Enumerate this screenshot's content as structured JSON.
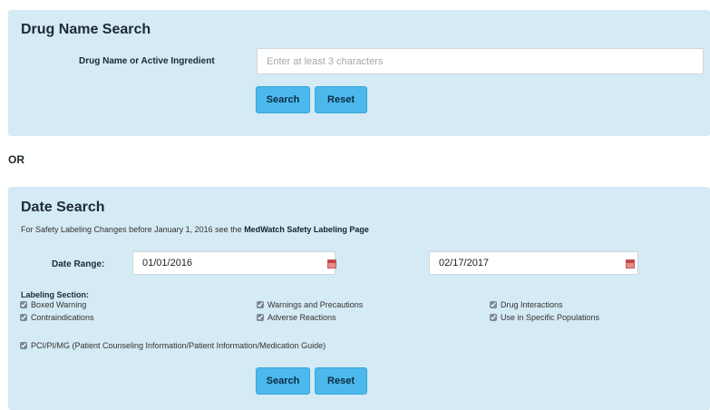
{
  "drug_search": {
    "title": "Drug Name Search",
    "field_label": "Drug Name or Active Ingredient",
    "placeholder": "Enter at least 3 characters",
    "value": "",
    "search_label": "Search",
    "reset_label": "Reset"
  },
  "or_label": "OR",
  "date_search": {
    "title": "Date Search",
    "note_prefix": "For Safety Labeling Changes before January 1, 2016 see the",
    "note_link": "MedWatch Safety Labeling Page",
    "date_range_label": "Date Range:",
    "start_date": "01/01/2016",
    "end_date": "02/17/2017",
    "calendar_icon": "calendar-icon",
    "labeling_section_label": "Labeling Section:",
    "checkboxes": [
      {
        "label": "Boxed Warning",
        "checked": true
      },
      {
        "label": "Warnings and Precautions",
        "checked": true
      },
      {
        "label": "Drug Interactions",
        "checked": true
      },
      {
        "label": "Contraindications",
        "checked": true
      },
      {
        "label": "Adverse Reactions",
        "checked": true
      },
      {
        "label": "Use in Specific Populations",
        "checked": true
      },
      {
        "label": "PCI/PI/MG (Patient Counseling Information/Patient Information/Medication Guide)",
        "checked": true
      }
    ],
    "search_label": "Search",
    "reset_label": "Reset"
  },
  "colors": {
    "panel_background": "#d4eaf5",
    "button_background": "#4bb9ec",
    "button_text": "#0b2c42",
    "calendar_icon": "#e58b8b"
  }
}
